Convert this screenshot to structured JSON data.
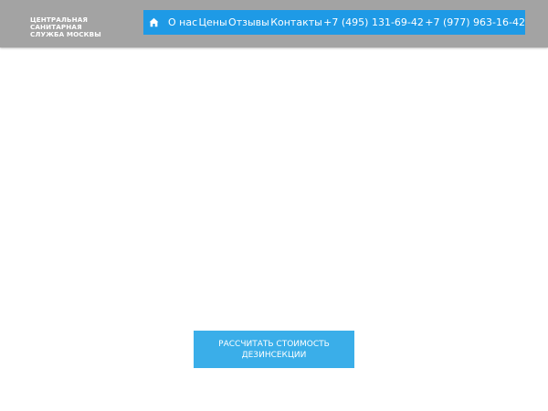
{
  "header": {
    "brand_line1": "ЦЕНТРАЛЬНАЯ САНИТАРНАЯ",
    "brand_line2": "СЛУЖБА МОСКВЫ"
  },
  "nav": {
    "home_icon": "home-icon",
    "items": [
      {
        "label": "О нас"
      },
      {
        "label": "Цены"
      },
      {
        "label": "Отзывы"
      },
      {
        "label": "Контакты"
      }
    ],
    "phones": [
      "+7 (495) 131-69-42",
      "+7 (977) 963-16-42"
    ]
  },
  "cta": {
    "line1": "РАССЧИТАТЬ СТОИМОСТЬ",
    "line2": "ДЕЗИНСЕКЦИИ"
  },
  "colors": {
    "header_bg": "#a3a3a3",
    "nav_bg": "#1e9ae6",
    "cta_bg": "#3aaee9",
    "text_light": "#ffffff"
  }
}
